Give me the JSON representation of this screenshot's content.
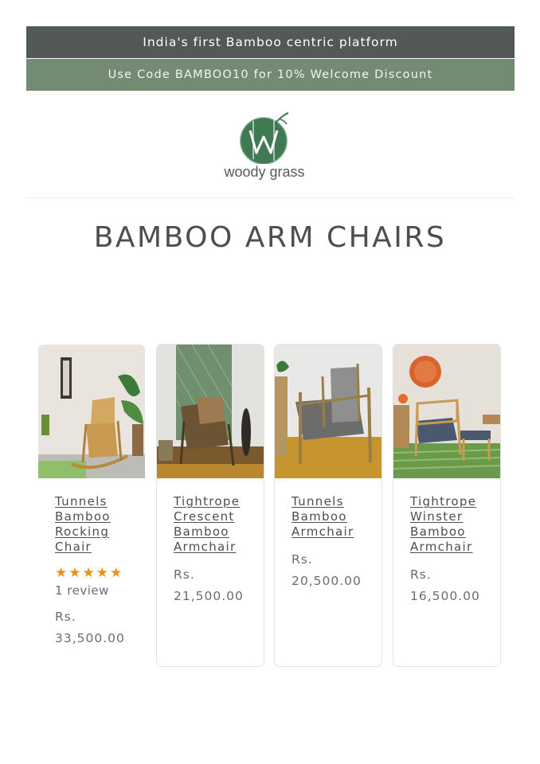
{
  "announcement": {
    "top": "India's first Bamboo centric platform",
    "promo": "Use Code BAMBOO10 for 10% Welcome Discount"
  },
  "logo": {
    "text": "woody grass",
    "icon": "bamboo-w-logo-icon",
    "color": "#3f7a55"
  },
  "page": {
    "title": "BAMBOO ARM CHAIRS"
  },
  "products": [
    {
      "name": [
        "Tunnels",
        "Bamboo",
        "Rocking",
        "Chair"
      ],
      "rating": 5,
      "stars": "★★★★★",
      "reviews": "1 review",
      "currency": "Rs.",
      "price": "33,500.00"
    },
    {
      "name": [
        "Tightrope",
        "Crescent",
        "Bamboo",
        "Armchair"
      ],
      "currency": "Rs.",
      "price": "21,500.00"
    },
    {
      "name": [
        "Tunnels",
        "Bamboo",
        "Armchair"
      ],
      "currency": "Rs.",
      "price": "20,500.00"
    },
    {
      "name": [
        "Tightrope",
        "Winster",
        "Bamboo",
        "Armchair"
      ],
      "currency": "Rs.",
      "price": "16,500.00"
    }
  ],
  "colors": {
    "top_bar": "#535958",
    "promo_bar": "#738b73",
    "star": "#ef8f13"
  }
}
